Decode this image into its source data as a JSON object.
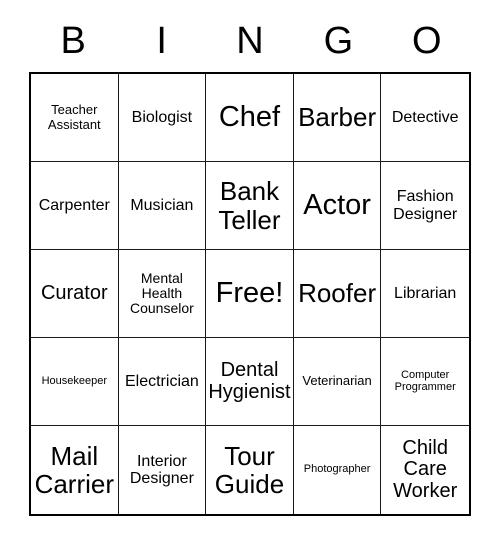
{
  "card": {
    "title_letters": [
      "B",
      "I",
      "N",
      "G",
      "O"
    ],
    "colors": {
      "background": "#ffffff",
      "text": "#000000",
      "grid_line": "#1a1a1a",
      "outer_border": "#000000"
    },
    "rows": [
      [
        {
          "label": "Teacher Assistant",
          "size": "sm"
        },
        {
          "label": "Biologist",
          "size": "md"
        },
        {
          "label": "Chef",
          "size": "xxl"
        },
        {
          "label": "Barber",
          "size": "xl"
        },
        {
          "label": "Detective",
          "size": "md"
        }
      ],
      [
        {
          "label": "Carpenter",
          "size": "md"
        },
        {
          "label": "Musician",
          "size": "md"
        },
        {
          "label": "Bank Teller",
          "size": "xl"
        },
        {
          "label": "Actor",
          "size": "xxl"
        },
        {
          "label": "Fashion Designer",
          "size": "md"
        }
      ],
      [
        {
          "label": "Curator",
          "size": "lg"
        },
        {
          "label": "Mental Health Counselor",
          "size": "smd"
        },
        {
          "label": "Free!",
          "size": "xxl"
        },
        {
          "label": "Roofer",
          "size": "xl"
        },
        {
          "label": "Librarian",
          "size": "md"
        }
      ],
      [
        {
          "label": "Housekeeper",
          "size": "xs"
        },
        {
          "label": "Electrician",
          "size": "md"
        },
        {
          "label": "Dental Hygienist",
          "size": "lg"
        },
        {
          "label": "Veterinarian",
          "size": "sm"
        },
        {
          "label": "Computer Programmer",
          "size": "xs"
        }
      ],
      [
        {
          "label": "Mail Carrier",
          "size": "xl"
        },
        {
          "label": "Interior Designer",
          "size": "md"
        },
        {
          "label": "Tour Guide",
          "size": "xl"
        },
        {
          "label": "Photographer",
          "size": "xs"
        },
        {
          "label": "Child Care Worker",
          "size": "lg"
        }
      ]
    ]
  }
}
